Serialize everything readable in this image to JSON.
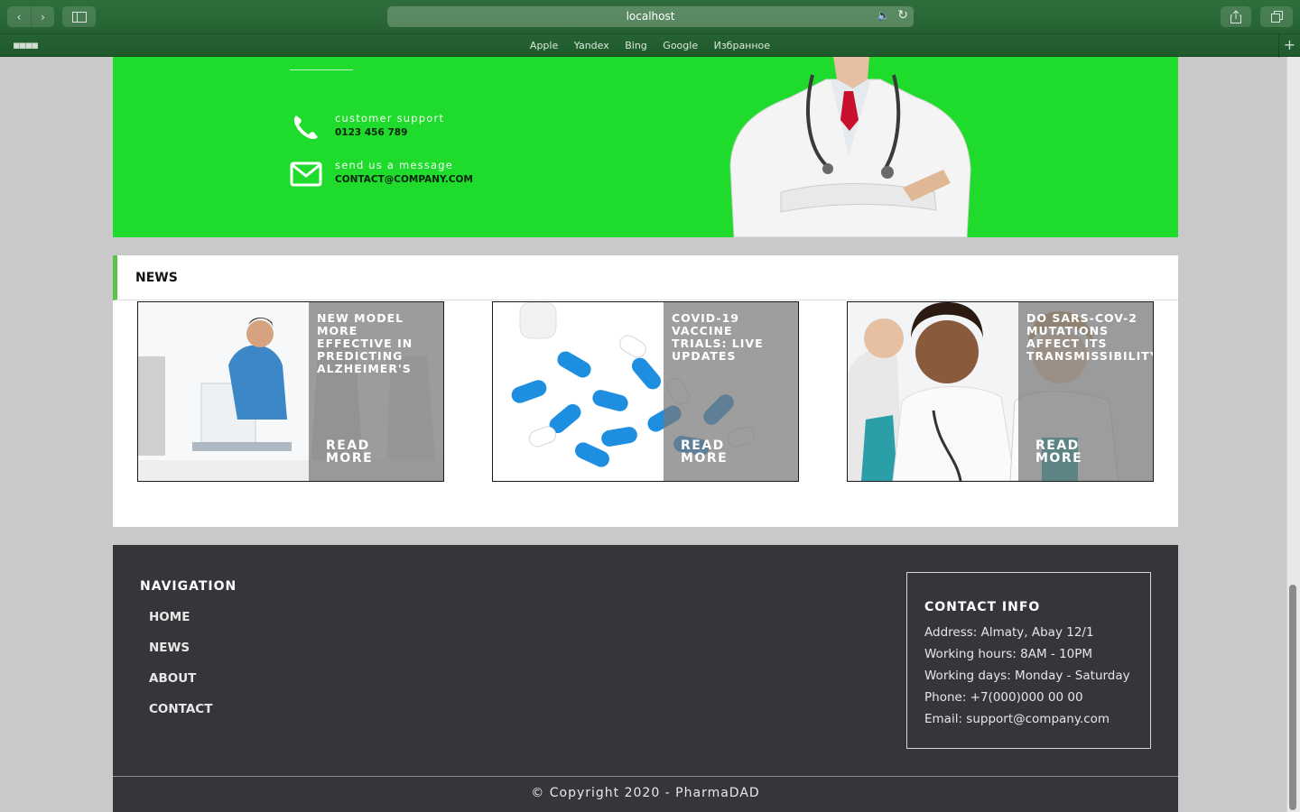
{
  "browser": {
    "url": "localhost",
    "favorites": [
      "Apple",
      "Yandex",
      "Bing",
      "Google",
      "Избранное"
    ]
  },
  "banner": {
    "support_label": "customer support",
    "support_phone": "0123 456 789",
    "message_label": "send us a message",
    "message_email": "CONTACT@COMPANY.COM"
  },
  "news": {
    "title": "NEWS",
    "cards": [
      {
        "headline": "NEW MODEL\nMORE\nEFFECTIVE IN\nPREDICTING\nALZHEIMER'S",
        "more": "READ\nMORE"
      },
      {
        "headline": "COVID-19\nVACCINE\nTRIALS: LIVE\nUPDATES",
        "more": "READ\nMORE"
      },
      {
        "headline": "DO SARS-COV-2\nMUTATIONS\nAFFECT ITS\nTRANSMISSIBILITY",
        "more": "READ\nMORE"
      }
    ]
  },
  "footer": {
    "nav_title": "NAVIGATION",
    "nav_items": [
      "HOME",
      "NEWS",
      "ABOUT",
      "CONTACT"
    ],
    "contact_title": "CONTACT INFO",
    "contact_lines": [
      "Address: Almaty, Abay 12/1",
      "Working hours: 8AM - 10PM",
      "Working days: Monday - Saturday",
      "Phone: +7(000)000 00 00",
      "Email: support@company.com"
    ],
    "copyright": "© Copyright 2020 - PharmaDAD"
  },
  "colors": {
    "banner_green": "#1fdb2c",
    "footer_dark": "#35363a",
    "news_accent": "#5cc34a"
  }
}
